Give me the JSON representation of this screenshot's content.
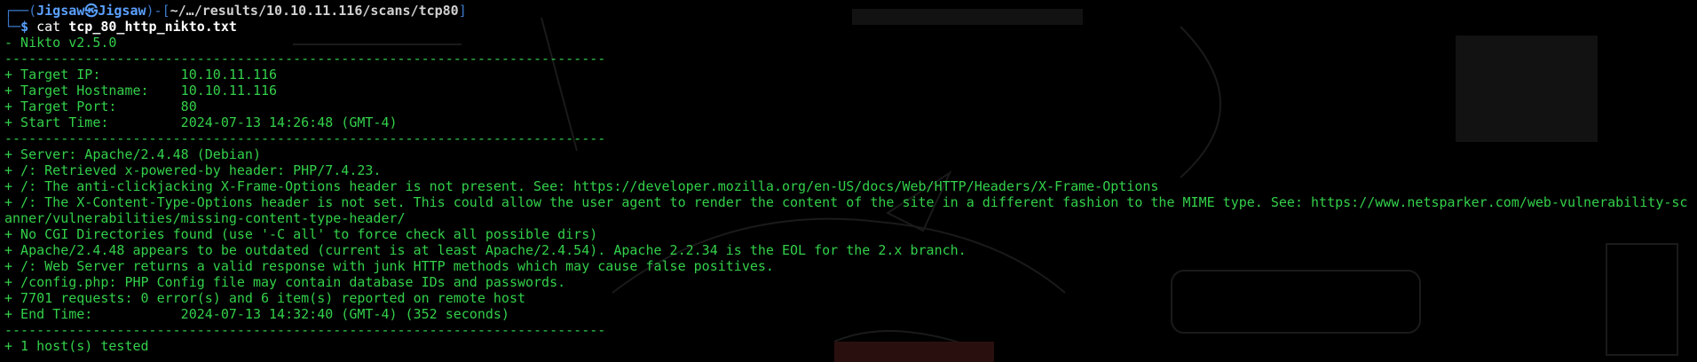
{
  "prompt": {
    "corner_top": "┌──",
    "open_paren": "(",
    "user": "Jigsaw",
    "at_symbol": "㉿",
    "host": "Jigsaw",
    "close_paren": ")",
    "dash": "-",
    "open_bracket": "[",
    "path": "~/…/results/10.10.11.116/scans/tcp80",
    "close_bracket": "]",
    "corner_bottom": "└─",
    "dollar": "$",
    "command": "cat",
    "argument": "tcp_80_http_nikto.txt"
  },
  "output": {
    "version": "- Nikto v2.5.0",
    "separator": "---------------------------------------------------------------------------",
    "target_ip": "+ Target IP:          10.10.11.116",
    "target_hostname": "+ Target Hostname:    10.10.11.116",
    "target_port": "+ Target Port:        80",
    "start_time": "+ Start Time:         2024-07-13 14:26:48 (GMT-4)",
    "findings": [
      "+ Server: Apache/2.4.48 (Debian)",
      "+ /: Retrieved x-powered-by header: PHP/7.4.23.",
      "+ /: The anti-clickjacking X-Frame-Options header is not present. See: https://developer.mozilla.org/en-US/docs/Web/HTTP/Headers/X-Frame-Options",
      "+ /: The X-Content-Type-Options header is not set. This could allow the user agent to render the content of the site in a different fashion to the MIME type. See: https://www.netsparker.com/web-vulnerability-sc",
      "anner/vulnerabilities/missing-content-type-header/",
      "+ No CGI Directories found (use '-C all' to force check all possible dirs)",
      "+ Apache/2.4.48 appears to be outdated (current is at least Apache/2.4.54). Apache 2.2.34 is the EOL for the 2.x branch.",
      "+ /: Web Server returns a valid response with junk HTTP methods which may cause false positives.",
      "+ /config.php: PHP Config file may contain database IDs and passwords.",
      "+ 7701 requests: 0 error(s) and 6 item(s) reported on remote host",
      "+ End Time:           2024-07-13 14:32:40 (GMT-4) (352 seconds)"
    ],
    "hosts_tested": "+ 1 host(s) tested"
  },
  "colors": {
    "background": "#000000",
    "output_green": "#33d04a",
    "prompt_blue": "#5aa0ff"
  }
}
